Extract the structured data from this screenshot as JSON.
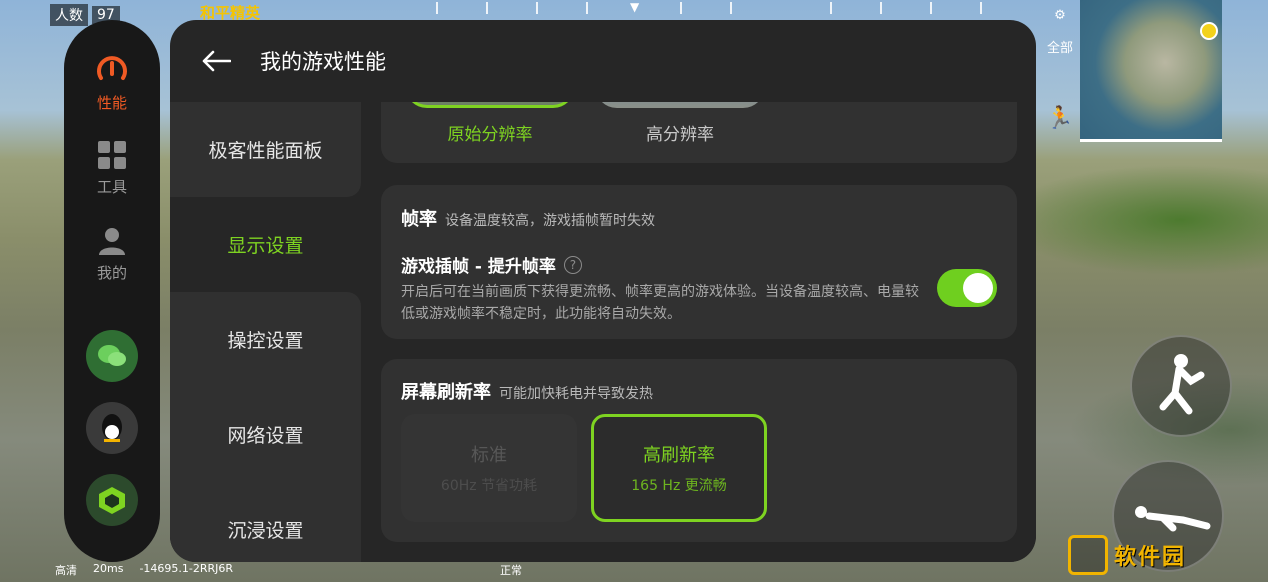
{
  "game_hud": {
    "players_label": "人数",
    "players_count": "97",
    "game_title": "和平精英",
    "minimap_filter": "全部",
    "quality": "高清",
    "ping": "20ms",
    "version": "-14695.1-2RRJ6R",
    "status": "正常",
    "watermark": "软件园"
  },
  "rail": {
    "items": [
      {
        "label": "性能",
        "icon": "gauge-icon"
      },
      {
        "label": "工具",
        "icon": "grid-icon"
      },
      {
        "label": "我的",
        "icon": "person-icon"
      }
    ],
    "apps": [
      "wechat-icon",
      "qq-icon",
      "game-app-icon"
    ],
    "accent": "#f05a24"
  },
  "panel": {
    "title": "我的游戏性能",
    "nav": [
      {
        "label": "极客性能面板"
      },
      {
        "label": "显示设置",
        "active": true
      },
      {
        "label": "操控设置"
      },
      {
        "label": "网络设置"
      },
      {
        "label": "沉浸设置"
      }
    ],
    "resolution": {
      "options": [
        "原始分辨率",
        "高分辨率"
      ],
      "selected": "原始分辨率"
    },
    "frame_rate": {
      "title": "帧率",
      "subtitle": "设备温度较高，游戏插帧暂时失效",
      "interp_title": "游戏插帧 - 提升帧率",
      "interp_desc": "开启后可在当前画质下获得更流畅、帧率更高的游戏体验。当设备温度较高、电量较低或游戏帧率不稳定时，此功能将自动失效。",
      "toggle_on": true
    },
    "refresh_rate": {
      "title": "屏幕刷新率",
      "subtitle": "可能加快耗电并导致发热",
      "standard": {
        "label": "标准",
        "desc": "60Hz 节省功耗"
      },
      "high": {
        "label": "高刷新率",
        "desc": "165 Hz 更流畅",
        "selected": true
      }
    },
    "accent": "#7ed321"
  }
}
